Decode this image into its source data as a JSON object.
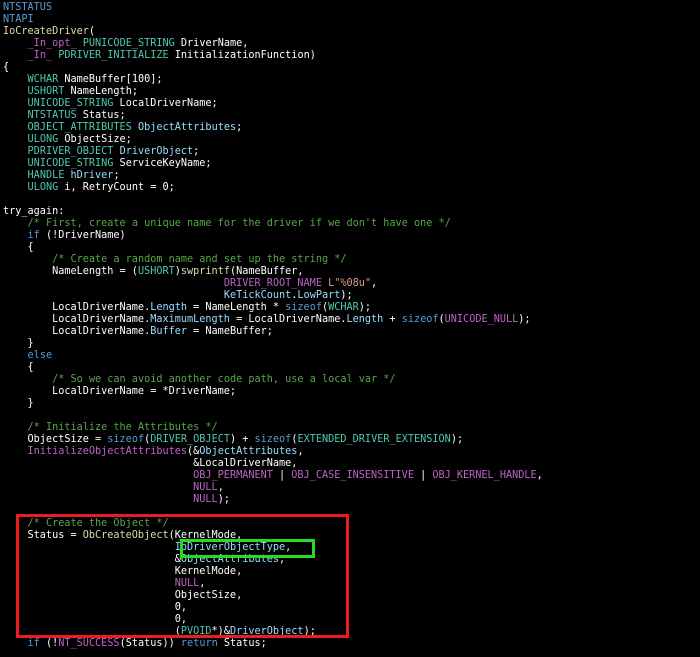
{
  "colors": {
    "background": "#000000",
    "keyword": "#569cd6",
    "type": "#4ec9b0",
    "function": "#dcdcaa",
    "comment": "#57a64a",
    "string": "#d69d85",
    "macro": "#bd63c5",
    "plain": "#ffffff",
    "param": "#9cdcfe",
    "highlight_red": "#ee1c1c",
    "highlight_green": "#22dd22"
  },
  "code_lines": [
    [
      [
        "kw",
        "NTSTATUS"
      ]
    ],
    [
      [
        "kw",
        "NTAPI"
      ]
    ],
    [
      [
        "fn",
        "IoCreateDriver"
      ],
      [
        "pl",
        "("
      ]
    ],
    [
      [
        "pl",
        "    "
      ],
      [
        "mc",
        "_In_opt_"
      ],
      [
        "pl",
        " "
      ],
      [
        "ty",
        "PUNICODE_STRING"
      ],
      [
        "pl",
        " DriverName,"
      ]
    ],
    [
      [
        "pl",
        "    "
      ],
      [
        "mc",
        "_In_"
      ],
      [
        "pl",
        " "
      ],
      [
        "ty",
        "PDRIVER_INITIALIZE"
      ],
      [
        "pl",
        " InitializationFunction)"
      ]
    ],
    [
      [
        "pl",
        "{"
      ]
    ],
    [
      [
        "pl",
        "    "
      ],
      [
        "ty",
        "WCHAR"
      ],
      [
        "pl",
        " NameBuffer[100];"
      ]
    ],
    [
      [
        "pl",
        "    "
      ],
      [
        "ty",
        "USHORT"
      ],
      [
        "pl",
        " NameLength;"
      ]
    ],
    [
      [
        "pl",
        "    "
      ],
      [
        "ty",
        "UNICODE_STRING"
      ],
      [
        "pl",
        " LocalDriverName;"
      ]
    ],
    [
      [
        "pl",
        "    "
      ],
      [
        "ty",
        "NTSTATUS"
      ],
      [
        "pl",
        " Status;"
      ]
    ],
    [
      [
        "pl",
        "    "
      ],
      [
        "ty",
        "OBJECT_ATTRIBUTES"
      ],
      [
        "pl",
        " "
      ],
      [
        "pa",
        "ObjectAttributes"
      ],
      [
        "pl",
        ";"
      ]
    ],
    [
      [
        "pl",
        "    "
      ],
      [
        "ty",
        "ULONG"
      ],
      [
        "pl",
        " ObjectSize;"
      ]
    ],
    [
      [
        "pl",
        "    "
      ],
      [
        "ty",
        "PDRIVER_OBJECT"
      ],
      [
        "pl",
        " "
      ],
      [
        "pa",
        "DriverObject"
      ],
      [
        "pl",
        ";"
      ]
    ],
    [
      [
        "pl",
        "    "
      ],
      [
        "ty",
        "UNICODE_STRING"
      ],
      [
        "pl",
        " ServiceKeyName;"
      ]
    ],
    [
      [
        "pl",
        "    "
      ],
      [
        "ty",
        "HANDLE"
      ],
      [
        "pl",
        " "
      ],
      [
        "pa",
        "hDriver"
      ],
      [
        "pl",
        ";"
      ]
    ],
    [
      [
        "pl",
        "    "
      ],
      [
        "ty",
        "ULONG"
      ],
      [
        "pl",
        " i, RetryCount = 0;"
      ]
    ],
    [
      [
        "pl",
        ""
      ]
    ],
    [
      [
        "pl",
        "try_again:"
      ]
    ],
    [
      [
        "pl",
        "    "
      ],
      [
        "cm",
        "/* First, create a unique name for the driver if we don't have one */"
      ]
    ],
    [
      [
        "pl",
        "    "
      ],
      [
        "kw",
        "if"
      ],
      [
        "pl",
        " (!DriverName)"
      ]
    ],
    [
      [
        "pl",
        "    {"
      ]
    ],
    [
      [
        "pl",
        "        "
      ],
      [
        "cm",
        "/* Create a random name and set up the string */"
      ]
    ],
    [
      [
        "pl",
        "        NameLength = ("
      ],
      [
        "ty",
        "USHORT"
      ],
      [
        "pl",
        ")"
      ],
      [
        "fn",
        "swprintf"
      ],
      [
        "pl",
        "(NameBuffer,"
      ]
    ],
    [
      [
        "pl",
        "                                    "
      ],
      [
        "mc",
        "DRIVER_ROOT_NAME"
      ],
      [
        "pl",
        " "
      ],
      [
        "st",
        "L\"%08u\""
      ],
      [
        "pl",
        ","
      ]
    ],
    [
      [
        "pl",
        "                                    "
      ],
      [
        "pa",
        "KeTickCount"
      ],
      [
        "pl",
        "."
      ],
      [
        "pa",
        "LowPart"
      ],
      [
        "pl",
        ");"
      ]
    ],
    [
      [
        "pl",
        "        LocalDriverName."
      ],
      [
        "pa",
        "Length"
      ],
      [
        "pl",
        " = NameLength * "
      ],
      [
        "kw",
        "sizeof"
      ],
      [
        "pl",
        "("
      ],
      [
        "ty",
        "WCHAR"
      ],
      [
        "pl",
        ");"
      ]
    ],
    [
      [
        "pl",
        "        LocalDriverName."
      ],
      [
        "pa",
        "MaximumLength"
      ],
      [
        "pl",
        " = LocalDriverName."
      ],
      [
        "pa",
        "Length"
      ],
      [
        "pl",
        " + "
      ],
      [
        "kw",
        "sizeof"
      ],
      [
        "pl",
        "("
      ],
      [
        "mc",
        "UNICODE_NULL"
      ],
      [
        "pl",
        ");"
      ]
    ],
    [
      [
        "pl",
        "        LocalDriverName."
      ],
      [
        "pa",
        "Buffer"
      ],
      [
        "pl",
        " = NameBuffer;"
      ]
    ],
    [
      [
        "pl",
        "    }"
      ]
    ],
    [
      [
        "pl",
        "    "
      ],
      [
        "kw",
        "else"
      ]
    ],
    [
      [
        "pl",
        "    {"
      ]
    ],
    [
      [
        "pl",
        "        "
      ],
      [
        "cm",
        "/* So we can avoid another code path, use a local var */"
      ]
    ],
    [
      [
        "pl",
        "        LocalDriverName = *DriverName;"
      ]
    ],
    [
      [
        "pl",
        "    }"
      ]
    ],
    [
      [
        "pl",
        ""
      ]
    ],
    [
      [
        "pl",
        "    "
      ],
      [
        "cm",
        "/* Initialize the Attributes */"
      ]
    ],
    [
      [
        "pl",
        "    ObjectSize = "
      ],
      [
        "kw",
        "sizeof"
      ],
      [
        "pl",
        "("
      ],
      [
        "ty",
        "DRIVER_OBJECT"
      ],
      [
        "pl",
        ") + "
      ],
      [
        "kw",
        "sizeof"
      ],
      [
        "pl",
        "("
      ],
      [
        "ty",
        "EXTENDED_DRIVER_EXTENSION"
      ],
      [
        "pl",
        ");"
      ]
    ],
    [
      [
        "pl",
        "    "
      ],
      [
        "mc",
        "InitializeObjectAttributes"
      ],
      [
        "pl",
        "(&"
      ],
      [
        "pa",
        "ObjectAttributes"
      ],
      [
        "pl",
        ","
      ]
    ],
    [
      [
        "pl",
        "                               &LocalDriverName,"
      ]
    ],
    [
      [
        "pl",
        "                               "
      ],
      [
        "mc",
        "OBJ_PERMANENT"
      ],
      [
        "pl",
        " | "
      ],
      [
        "mc",
        "OBJ_CASE_INSENSITIVE"
      ],
      [
        "pl",
        " | "
      ],
      [
        "mc",
        "OBJ_KERNEL_HANDLE"
      ],
      [
        "pl",
        ","
      ]
    ],
    [
      [
        "pl",
        "                               "
      ],
      [
        "mc",
        "NULL"
      ],
      [
        "pl",
        ","
      ]
    ],
    [
      [
        "pl",
        "                               "
      ],
      [
        "mc",
        "NULL"
      ],
      [
        "pl",
        ");"
      ]
    ],
    [
      [
        "pl",
        ""
      ]
    ],
    [
      [
        "pl",
        "    "
      ],
      [
        "cm",
        "/* Create the Object */"
      ]
    ],
    [
      [
        "pl",
        "    Status = "
      ],
      [
        "fn",
        "ObCreateObject"
      ],
      [
        "pl",
        "(KernelMode,"
      ]
    ],
    [
      [
        "pl",
        "                            "
      ],
      [
        "pa",
        "IoDriverObjectType"
      ],
      [
        "pl",
        ","
      ]
    ],
    [
      [
        "pl",
        "                            &"
      ],
      [
        "pa",
        "ObjectAttributes"
      ],
      [
        "pl",
        ","
      ]
    ],
    [
      [
        "pl",
        "                            KernelMode,"
      ]
    ],
    [
      [
        "pl",
        "                            "
      ],
      [
        "mc",
        "NULL"
      ],
      [
        "pl",
        ","
      ]
    ],
    [
      [
        "pl",
        "                            ObjectSize,"
      ]
    ],
    [
      [
        "pl",
        "                            0,"
      ]
    ],
    [
      [
        "pl",
        "                            0,"
      ]
    ],
    [
      [
        "pl",
        "                            ("
      ],
      [
        "ty",
        "PVOID"
      ],
      [
        "pl",
        "*)&"
      ],
      [
        "pa",
        "DriverObject"
      ],
      [
        "pl",
        ");"
      ]
    ],
    [
      [
        "pl",
        "    "
      ],
      [
        "kw",
        "if"
      ],
      [
        "pl",
        " (!"
      ],
      [
        "mc",
        "NT_SUCCESS"
      ],
      [
        "pl",
        "(Status)) "
      ],
      [
        "kw",
        "return"
      ],
      [
        "pl",
        " Status;"
      ]
    ]
  ]
}
